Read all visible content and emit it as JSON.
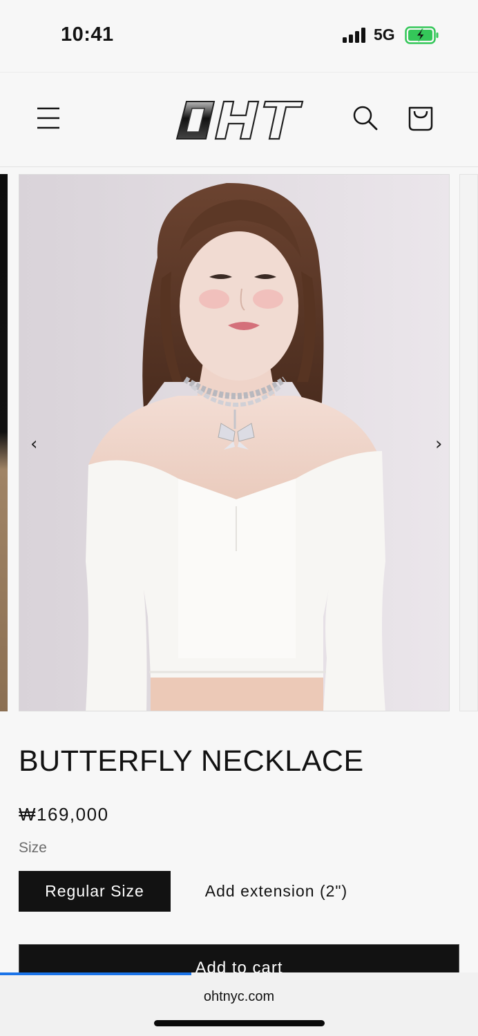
{
  "status_bar": {
    "time": "10:41",
    "network": "5G",
    "icons": [
      "signal-icon",
      "battery-charging-icon"
    ],
    "battery_color": "#34c759"
  },
  "header": {
    "logo_text": "OHT",
    "icons": [
      "menu-icon",
      "search-icon",
      "cart-icon"
    ]
  },
  "gallery": {
    "prev_arrow": "‹",
    "next_arrow": "›",
    "image_description_icon": "product-photo"
  },
  "product": {
    "title": "BUTTERFLY NECKLACE",
    "price": "₩169,000",
    "size_label": "Size",
    "variants": [
      {
        "label": "Regular Size",
        "selected": true
      },
      {
        "label": "Add extension (2\")",
        "selected": false
      }
    ],
    "add_to_cart_label": "Add to cart"
  },
  "browser": {
    "url": "ohtnyc.com",
    "load_progress": 0.4,
    "progress_color": "#1a73e8"
  },
  "colors": {
    "primary": "#121212",
    "background": "#f7f7f7"
  }
}
